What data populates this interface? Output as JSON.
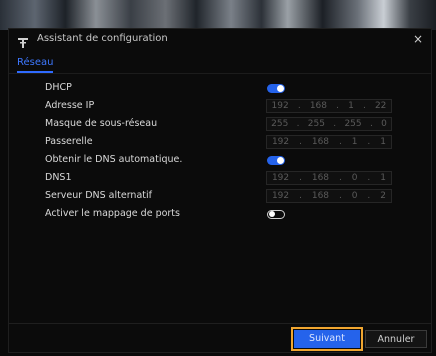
{
  "dialog": {
    "title": "Assistant de configuration",
    "close_label": "×"
  },
  "tabs": [
    {
      "label": "Réseau",
      "active": true
    }
  ],
  "form": {
    "dhcp": {
      "label": "DHCP",
      "enabled": true
    },
    "ip_address": {
      "label": "Adresse IP",
      "octets": [
        "192",
        "168",
        "1",
        "22"
      ]
    },
    "subnet_mask": {
      "label": "Masque de sous-réseau",
      "octets": [
        "255",
        "255",
        "255",
        "0"
      ]
    },
    "gateway": {
      "label": "Passerelle",
      "octets": [
        "192",
        "168",
        "1",
        "1"
      ]
    },
    "auto_dns": {
      "label": "Obtenir le DNS automatique.",
      "enabled": true
    },
    "dns1": {
      "label": "DNS1",
      "octets": [
        "192",
        "168",
        "0",
        "1"
      ]
    },
    "alt_dns": {
      "label": "Serveur DNS alternatif",
      "octets": [
        "192",
        "168",
        "0",
        "2"
      ]
    },
    "port_mapping": {
      "label": "Activer le mappage de ports",
      "enabled": false
    }
  },
  "buttons": {
    "next_label": "Suivant",
    "cancel_label": "Annuler"
  },
  "colors": {
    "accent": "#2563eb",
    "highlight": "#f0a630",
    "background": "#0b0b0b"
  }
}
